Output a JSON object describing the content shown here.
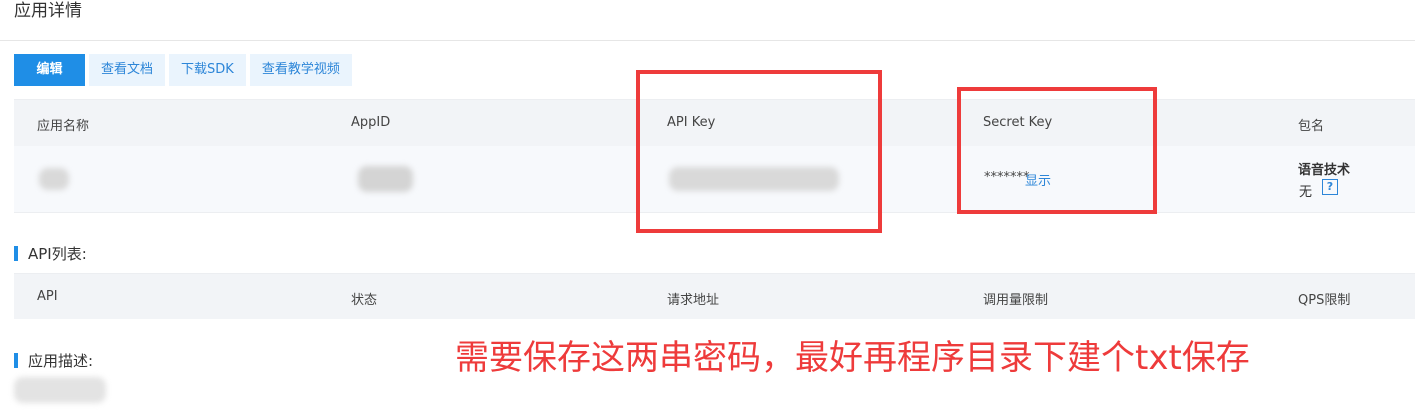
{
  "page": {
    "title": "应用详情"
  },
  "toolbar": {
    "edit_label": "编辑",
    "docs_label": "查看文档",
    "sdk_label": "下载SDK",
    "video_label": "查看教学视频"
  },
  "app_table": {
    "headers": [
      "应用名称",
      "AppID",
      "API Key",
      "Secret Key",
      "包名"
    ],
    "row": {
      "secret_key_mask": "*******",
      "show_label": "显示",
      "package_name": "语音技术",
      "package_value": "无",
      "help_label": "?"
    }
  },
  "api_section": {
    "title": "API列表:",
    "headers": [
      "API",
      "状态",
      "请求地址",
      "调用量限制",
      "QPS限制"
    ]
  },
  "description_section": {
    "title": "应用描述:"
  },
  "annotation": {
    "text": "需要保存这两串密码，最好再程序目录下建个txt保存"
  },
  "colors": {
    "primary": "#1f8ee6",
    "link": "#2d86d8",
    "annotation_red": "#ee3b3b",
    "header_bg": "#f2f4f7"
  }
}
